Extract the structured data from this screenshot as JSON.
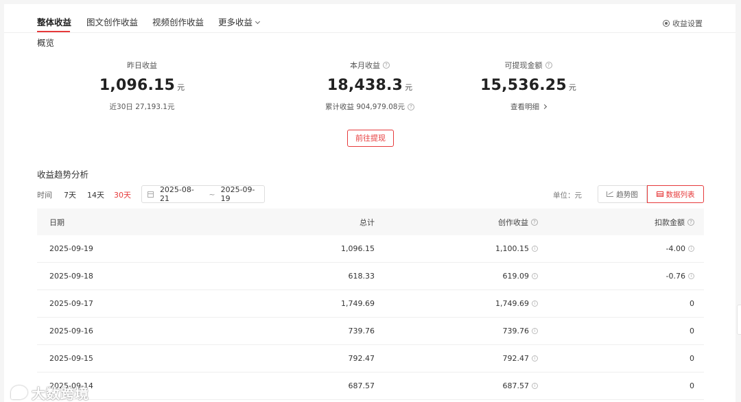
{
  "tabs": [
    {
      "label": "整体收益",
      "active": true
    },
    {
      "label": "图文创作收益",
      "active": false
    },
    {
      "label": "视频创作收益",
      "active": false
    },
    {
      "label": "更多收益",
      "active": false
    }
  ],
  "settings_label": "收益设置",
  "overview": {
    "title": "概览",
    "stats": [
      {
        "label": "昨日收益",
        "value": "1,096.15",
        "unit": "元",
        "sub": "近30日 27,193.1元"
      },
      {
        "label": "本月收益",
        "value": "18,438.3",
        "unit": "元",
        "sub": "累计收益 904,979.08元"
      },
      {
        "label": "可提现金额",
        "value": "15,536.25",
        "unit": "元",
        "sub": "查看明细"
      }
    ],
    "withdraw_button": "前往提现"
  },
  "trend": {
    "title": "收益趋势分析",
    "time_label": "时间",
    "ranges": [
      "7天",
      "14天",
      "30天"
    ],
    "active_range": "30天",
    "date_start": "2025-08-21",
    "date_sep": "~",
    "date_end": "2025-09-19",
    "unit_label": "单位：元",
    "view_chart": "趋势图",
    "view_table": "数据列表"
  },
  "table": {
    "headers": [
      "日期",
      "总计",
      "创作收益",
      "扣款金额"
    ],
    "rows": [
      [
        "2025-09-19",
        "1,096.15",
        "1,100.15",
        "-4.00"
      ],
      [
        "2025-09-18",
        "618.33",
        "619.09",
        "-0.76"
      ],
      [
        "2025-09-17",
        "1,749.69",
        "1,749.69",
        "0"
      ],
      [
        "2025-09-16",
        "739.76",
        "739.76",
        "0"
      ],
      [
        "2025-09-15",
        "792.47",
        "792.47",
        "0"
      ],
      [
        "2025-09-14",
        "687.57",
        "687.57",
        "0"
      ]
    ]
  },
  "watermark": "大数跨境",
  "colors": {
    "accent": "#e6393a",
    "header_bg": "#f7f7f7",
    "page_bg": "#f5f5f5"
  }
}
